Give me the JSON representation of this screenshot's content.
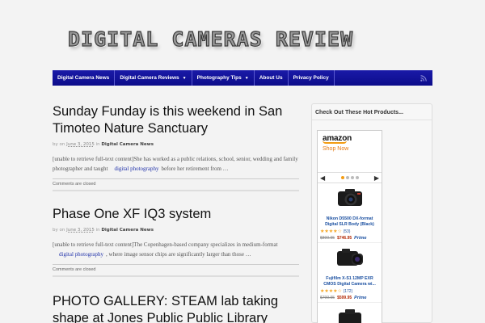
{
  "site": {
    "logo_text": "DIGITAL CAMERAS REVIEW"
  },
  "nav": {
    "items": [
      {
        "label": "Digital Camera News",
        "dropdown": false
      },
      {
        "label": "Digital Camera Reviews",
        "dropdown": true
      },
      {
        "label": "Photography Tips",
        "dropdown": true
      },
      {
        "label": "About Us",
        "dropdown": false
      },
      {
        "label": "Privacy Policy",
        "dropdown": false
      }
    ],
    "rss_icon": "rss-icon",
    "bg_color": "#0c0c8a"
  },
  "posts": [
    {
      "title": "Sunday Funday is this weekend in San Timoteo Nature Sanctuary",
      "meta_by": "by",
      "meta_on": "on",
      "date": "June 3, 2015",
      "meta_in": "in",
      "category": "Digital Camera News",
      "excerpt_before": "[unable to retrieve full-text content]She has worked as a public relations, school, senior, wedding and family photographer and taught",
      "link_text": "digital photography",
      "excerpt_after": "before her retirement from …",
      "comments": "Comments are closed"
    },
    {
      "title": "Phase One XF IQ3 system",
      "meta_by": "by",
      "meta_on": "on",
      "date": "June 3, 2015",
      "meta_in": "in",
      "category": "Digital Camera News",
      "excerpt_before": "[unable to retrieve full-text content]The Copenhagen-based company specializes in medium-format",
      "link_text": "digital photography",
      "excerpt_after": ", where image sensor chips are significantly larger than those …",
      "comments": "Comments are closed"
    },
    {
      "title": "PHOTO GALLERY: STEAM lab taking shape at Jones Public Public Library"
    }
  ],
  "sidebar": {
    "heading": "Check Out These Hot Products...",
    "amazon": {
      "logo": "amazon",
      "shop_now": "Shop  Now",
      "prev_icon": "chevron-left-icon",
      "next_icon": "chevron-right-icon",
      "products": [
        {
          "name": "Nikon D5500 DX-format Digital SLR Body (Black)",
          "stars": "★★★★☆",
          "reviews": "(53)",
          "old_price": "$899.95",
          "new_price": "$746.95",
          "prime": "Prime"
        },
        {
          "name": "Fujifilm X-S1 12MP EXR CMOS Digital Camera wi...",
          "stars": "★★★★☆",
          "reviews": "(172)",
          "old_price": "$799.95",
          "new_price": "$599.95",
          "prime": "Prime"
        }
      ]
    }
  }
}
